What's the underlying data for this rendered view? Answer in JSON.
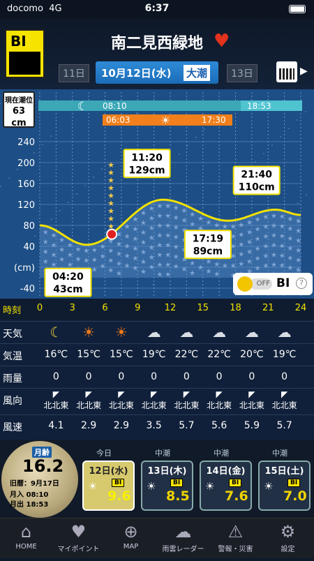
{
  "status": {
    "carrier": "docomo",
    "network": "4G",
    "time": "6:37"
  },
  "header": {
    "brand": "BI",
    "location": "南二見西緑地",
    "prev_day": "11日",
    "current_date": "10月12日(水)",
    "tide_type": "大潮",
    "next_day": "13日"
  },
  "current_tide": {
    "label": "現在潮位",
    "value": "63",
    "unit": "cm"
  },
  "chart_data": {
    "type": "line",
    "moon_bar": {
      "start": "",
      "end": "08:10",
      "next": "18:53"
    },
    "sun_bar": {
      "rise": "06:03",
      "set": "17:30"
    },
    "y_ticks": [
      "240",
      "200",
      "160",
      "120",
      "80",
      "40",
      "(cm)",
      "-40"
    ],
    "ylim": [
      -40,
      270
    ],
    "xlim": [
      0,
      24
    ],
    "tide": {
      "x": [
        0,
        4.33,
        11.33,
        17.32,
        21.67,
        24
      ],
      "y": [
        80,
        43,
        129,
        89,
        110,
        100
      ]
    },
    "extremes": [
      {
        "time": "04:20",
        "value": "43cm",
        "x": 4.33,
        "y": 43
      },
      {
        "time": "11:20",
        "value": "129cm",
        "x": 11.33,
        "y": 129
      },
      {
        "time": "17:19",
        "value": "89cm",
        "x": 17.32,
        "y": 89
      },
      {
        "time": "21:40",
        "value": "110cm",
        "x": 21.67,
        "y": 110
      }
    ],
    "current": {
      "x": 6.62,
      "y": 63
    }
  },
  "toggle": {
    "state": "OFF",
    "label": "BI",
    "help": "?"
  },
  "table": {
    "hours_label": "時刻",
    "hours": [
      "0",
      "3",
      "6",
      "9",
      "12",
      "15",
      "18",
      "21",
      "24"
    ],
    "rows": [
      {
        "label": "天気",
        "values": [
          "☾",
          "☀",
          "☀",
          "☁",
          "☁",
          "☁",
          "☁",
          "☁"
        ]
      },
      {
        "label": "気温",
        "values": [
          "16℃",
          "15℃",
          "15℃",
          "19℃",
          "22℃",
          "22℃",
          "20℃",
          "19℃"
        ]
      },
      {
        "label": "雨量",
        "values": [
          "0",
          "0",
          "0",
          "0",
          "0",
          "0",
          "0",
          "0"
        ]
      },
      {
        "label": "風向",
        "values": [
          "北北東",
          "北北東",
          "北北東",
          "北北東",
          "北北東",
          "北北東",
          "北北東",
          "北北東"
        ]
      },
      {
        "label": "風速",
        "values": [
          "4.1",
          "2.9",
          "2.9",
          "3.5",
          "5.7",
          "5.6",
          "5.9",
          "5.7"
        ]
      }
    ]
  },
  "moon": {
    "title": "月齢",
    "age": "16.2",
    "lunar": "旧暦：9月17日",
    "moonset": "月入 08:10",
    "moonrise": "月出 18:53"
  },
  "forecast": [
    {
      "tag": "今日",
      "date": "12日(水)",
      "bi": "BI",
      "score": "9.6"
    },
    {
      "tag": "中潮",
      "date": "13日(木)",
      "bi": "BI",
      "score": "8.5"
    },
    {
      "tag": "中潮",
      "date": "14日(金)",
      "bi": "BI",
      "score": "7.6"
    },
    {
      "tag": "中潮",
      "date": "15日(土)",
      "bi": "BI",
      "score": "7.0"
    }
  ],
  "tabs": [
    {
      "label": "HOME",
      "icon": "home-icon"
    },
    {
      "label": "マイポイント",
      "icon": "heart-icon"
    },
    {
      "label": "MAP",
      "icon": "crosshair-icon"
    },
    {
      "label": "雨雲レーダー",
      "icon": "rain-cloud-icon"
    },
    {
      "label": "警報・災害",
      "icon": "warning-icon"
    },
    {
      "label": "設定",
      "icon": "gear-icon"
    }
  ]
}
